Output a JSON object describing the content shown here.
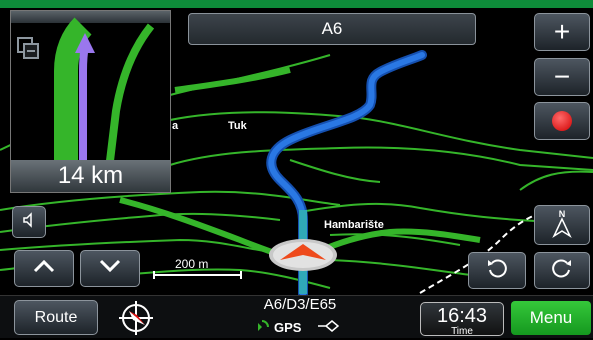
{
  "header": {
    "road_title": "A6"
  },
  "mini_map": {
    "distance": "14 km"
  },
  "map_labels": {
    "place_1": "Tuk",
    "place_2": "Hambarište",
    "place_partial": "a"
  },
  "scale": {
    "text": "200 m"
  },
  "zoom": {
    "in_label": "+",
    "out_label": "−"
  },
  "status_bar": {
    "route_label": "Route",
    "road_name": "A6/D3/E65",
    "gps_label": "GPS",
    "time_value": "16:43",
    "time_label": "Time",
    "menu_label": "Menu"
  },
  "colors": {
    "route": "#2a78e4",
    "roads": "#35b52a",
    "record": "#e01010",
    "menu": "#22b52c"
  }
}
